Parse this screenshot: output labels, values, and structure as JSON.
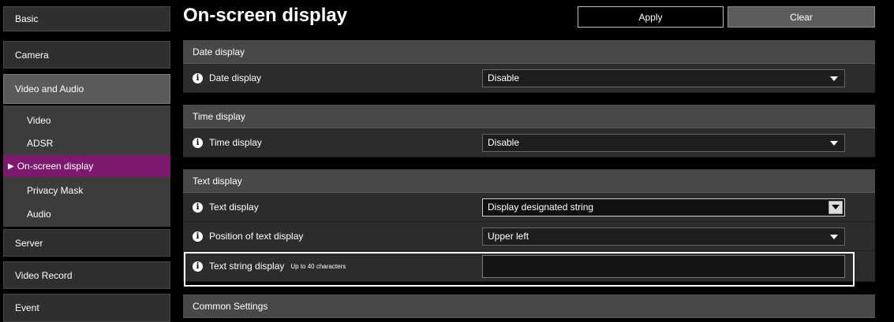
{
  "sidebar": {
    "items": [
      {
        "label": "Basic"
      },
      {
        "label": "Camera"
      },
      {
        "label": "Video and Audio"
      },
      {
        "label": "Server"
      },
      {
        "label": "Video Record"
      },
      {
        "label": "Event"
      }
    ],
    "sub_items": [
      {
        "label": "Video"
      },
      {
        "label": "ADSR"
      },
      {
        "label": "On-screen display",
        "active": true
      },
      {
        "label": "Privacy Mask"
      },
      {
        "label": "Audio"
      }
    ],
    "active_marker": "▶"
  },
  "header": {
    "title": "On-screen display",
    "apply_label": "Apply",
    "clear_label": "Clear"
  },
  "sections": {
    "date": {
      "title": "Date display",
      "rows": [
        {
          "label": "Date display",
          "value": "Disable"
        }
      ]
    },
    "time": {
      "title": "Time display",
      "rows": [
        {
          "label": "Time display",
          "value": "Disable"
        }
      ]
    },
    "text": {
      "title": "Text display",
      "rows": [
        {
          "label": "Text display",
          "value": "Display designated string"
        },
        {
          "label": "Position of text display",
          "value": "Upper left"
        },
        {
          "label": "Text string display",
          "hint": "Up to 40 characters",
          "value": ""
        }
      ]
    },
    "common": {
      "title": "Common Settings"
    }
  },
  "icons": {
    "info": "info-icon",
    "info_glyph": "i"
  },
  "colors": {
    "active_nav": "#7d1a6d",
    "section_header": "#484848"
  }
}
